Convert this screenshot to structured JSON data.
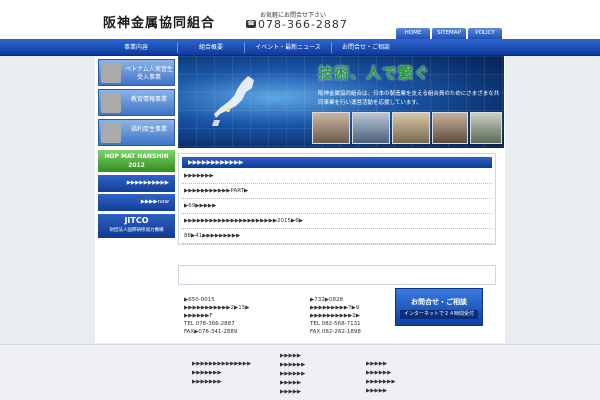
{
  "header": {
    "logo": "阪神金属協同組合",
    "contact_small": "お気軽にお問合せ下さい",
    "phone": "078-366-2887",
    "tabs": [
      "HOME",
      "SITEMAP",
      "POLICY"
    ]
  },
  "nav": {
    "items": [
      "事業内容",
      "組合概要",
      "イベント・最新ニュース",
      "お問合せ・ご相談"
    ]
  },
  "banner": {
    "title": "技術、人で繋ぐ",
    "desc": "阪神金属協同組合は、日本の製造業を支える組合員のためにさまざまな共同事業を行い運営活動を応援しています。"
  },
  "left_buttons": [
    {
      "label": "ベトナム人実習生受入事業"
    },
    {
      "label": "教育情報事業"
    },
    {
      "label": "福利厚生事業"
    }
  ],
  "hop": {
    "line1": "HOP MAT HANSHIN",
    "line2": "2012"
  },
  "side_links": [
    "▶▶▶▶▶▶▶▶▶▶",
    "▶▶▶▶now"
  ],
  "jitco": {
    "title": "JITCO",
    "sub": "財団法人国際研修協力機構"
  },
  "news": {
    "heading": "▶▶▶▶▶▶▶▶▶▶▶▶",
    "rows": [
      "▶▶▶▶▶▶▶",
      "▶▶▶▶▶▶▶▶▶▶▶PART▶",
      "▶69▶▶▶▶▶",
      "▶▶▶▶▶▶▶▶▶▶▶▶▶▶▶▶▶▶▶▶▶▶2015▶6▶",
      "88▶41▶▶▶▶▶▶▶▶▶"
    ]
  },
  "address_left": [
    "▶650-0015",
    "▶▶▶▶▶▶▶▶▶▶▶2▶15▶",
    "▶▶▶▶▶▶F",
    "TEL 078-366-2887",
    "FAX▶078-341-2889"
  ],
  "address_right": [
    "▶732▶0828",
    "▶▶▶▶▶▶▶▶▶7▶9",
    "▶▶▶▶▶▶▶▶▶▶2▶",
    "TEL 082-568-7131",
    "FAX 082-262-1898"
  ],
  "inquiry": {
    "title": "お問合せ・ご相談",
    "sub": "インターネットで２４時間受付"
  },
  "footer": {
    "col1": [
      "▶▶▶▶▶▶▶▶▶▶▶▶▶▶",
      "▶▶▶▶▶▶▶",
      "▶▶▶▶▶▶▶"
    ],
    "col2": [
      "▶▶▶▶▶",
      "▶▶▶▶▶▶",
      "▶▶▶▶▶▶",
      "▶▶▶▶▶",
      "▶▶▶▶▶"
    ],
    "col3": [
      "▶▶▶▶▶",
      "▶▶▶▶▶▶",
      "▶▶▶▶▶▶▶",
      "▶▶▶▶▶"
    ]
  }
}
